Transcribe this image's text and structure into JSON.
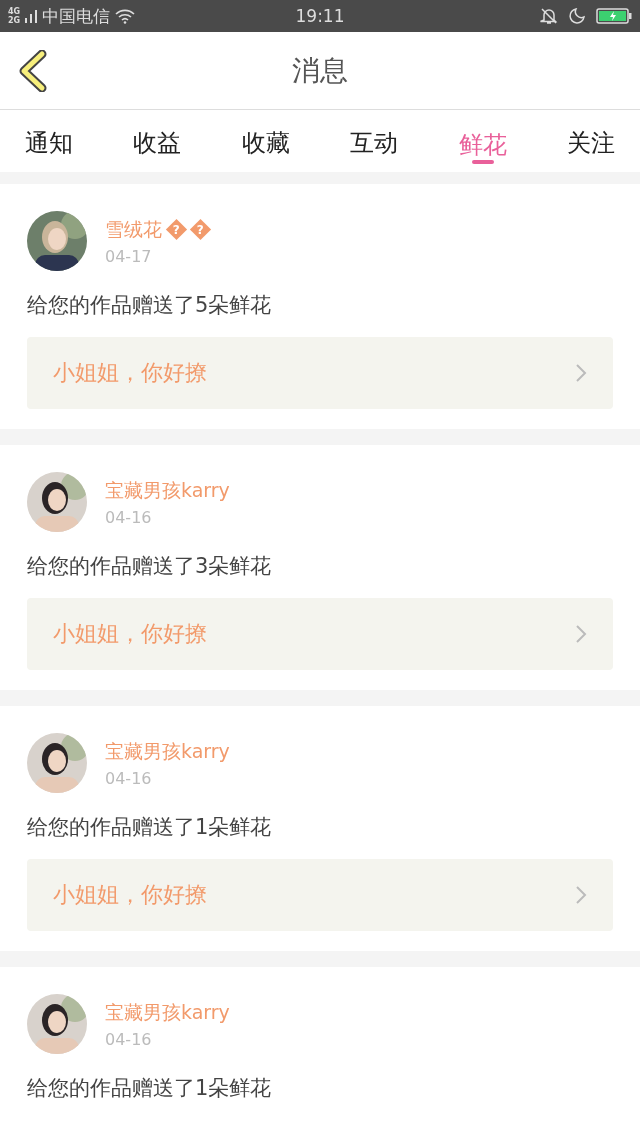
{
  "status_bar": {
    "network": "4G 2G",
    "carrier": "中国电信",
    "time": "19:11"
  },
  "header": {
    "title": "消息"
  },
  "tabs": [
    {
      "label": "通知",
      "selected": false
    },
    {
      "label": "收益",
      "selected": false
    },
    {
      "label": "收藏",
      "selected": false
    },
    {
      "label": "互动",
      "selected": false
    },
    {
      "label": "鲜花",
      "selected": true
    },
    {
      "label": "关注",
      "selected": false
    }
  ],
  "messages": [
    {
      "kind": "picture",
      "user": "雪绒花",
      "unknown_glyphs": [
        "?",
        "?"
      ],
      "date": "04-17",
      "text": "给您的作品赠送了5朵鲜花",
      "reply": "小姐姐，你好撩"
    },
    {
      "kind": "picture",
      "user": "宝藏男孩karry",
      "date": "04-16",
      "text": "给您的作品赠送了3朵鲜花",
      "reply": "小姐姐，你好撩"
    },
    {
      "kind": "picture",
      "user": "宝藏男孩karry",
      "date": "04-16",
      "text": "给您的作品赠送了1朵鲜花",
      "reply": "小姐姐，你好撩"
    },
    {
      "kind": "picture",
      "user": "宝藏男孩karry",
      "date": "04-16",
      "text": "给您的作品赠送了1朵鲜花"
    }
  ]
}
